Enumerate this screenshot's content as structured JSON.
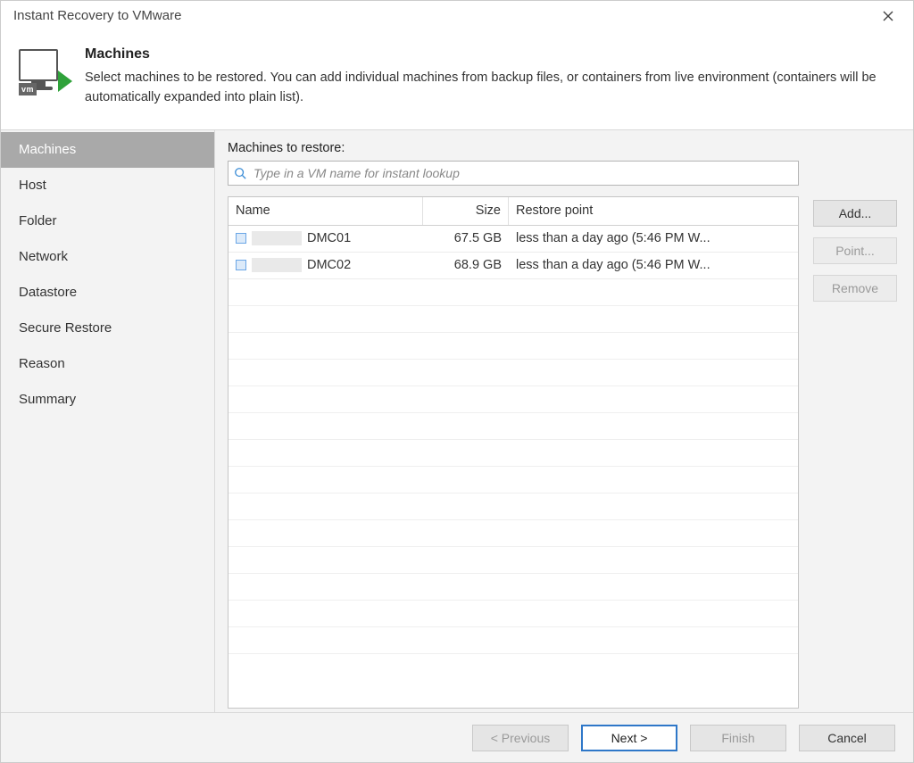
{
  "window": {
    "title": "Instant Recovery to VMware"
  },
  "header": {
    "title": "Machines",
    "description": "Select machines to be restored. You can add individual machines from backup files, or containers from live environment (containers will be automatically expanded into plain list).",
    "icon_badge": "vm"
  },
  "steps": [
    {
      "label": "Machines",
      "active": true
    },
    {
      "label": "Host",
      "active": false
    },
    {
      "label": "Folder",
      "active": false
    },
    {
      "label": "Network",
      "active": false
    },
    {
      "label": "Datastore",
      "active": false
    },
    {
      "label": "Secure Restore",
      "active": false
    },
    {
      "label": "Reason",
      "active": false
    },
    {
      "label": "Summary",
      "active": false
    }
  ],
  "content": {
    "section_label": "Machines to restore:",
    "search_placeholder": "Type in a VM name for instant lookup",
    "columns": {
      "name": "Name",
      "size": "Size",
      "restore_point": "Restore point"
    },
    "rows": [
      {
        "name": "DMC01",
        "size": "67.5 GB",
        "restore_point": "less than a day ago (5:46 PM W..."
      },
      {
        "name": "DMC02",
        "size": "68.9 GB",
        "restore_point": "less than a day ago (5:46 PM W..."
      }
    ]
  },
  "side_buttons": {
    "add": "Add...",
    "point": "Point...",
    "remove": "Remove"
  },
  "footer": {
    "previous": "< Previous",
    "next": "Next >",
    "finish": "Finish",
    "cancel": "Cancel"
  }
}
